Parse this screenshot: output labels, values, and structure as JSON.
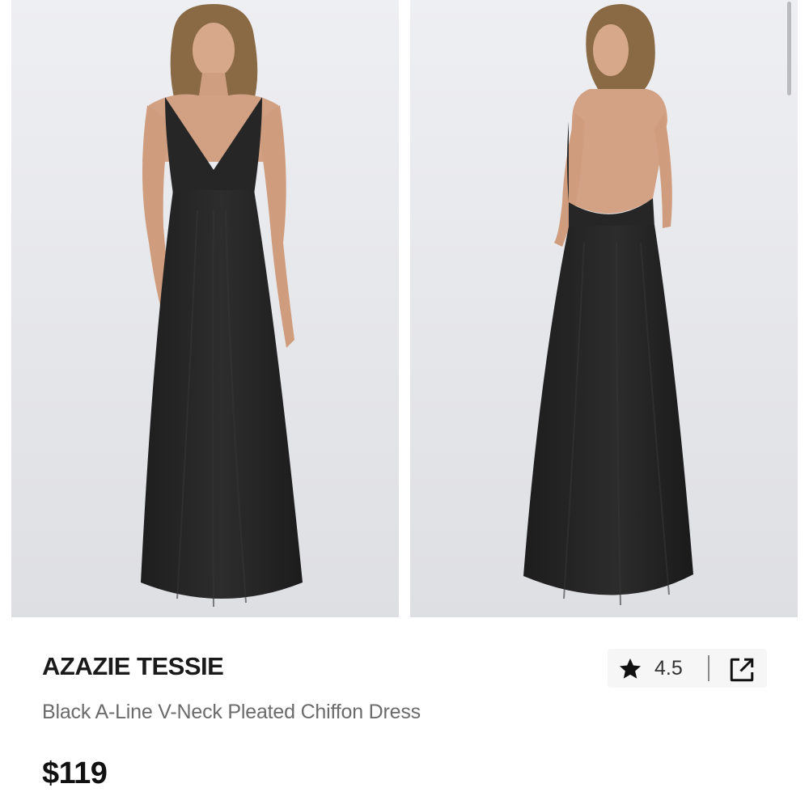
{
  "product": {
    "brand": "AZAZIE TESSIE",
    "name": "Black A-Line V-Neck Pleated Chiffon Dress",
    "price": "$119",
    "rating": "4.5"
  },
  "gallery": {
    "images": [
      "front-view-photo",
      "back-view-photo"
    ]
  },
  "icons": {
    "rating": "star-icon",
    "share": "external-link-icon"
  },
  "colors": {
    "dress": "#262626",
    "background": "#e5e6ea",
    "brand_text": "#1a1a1a",
    "secondary_text": "#6b6b6b"
  }
}
